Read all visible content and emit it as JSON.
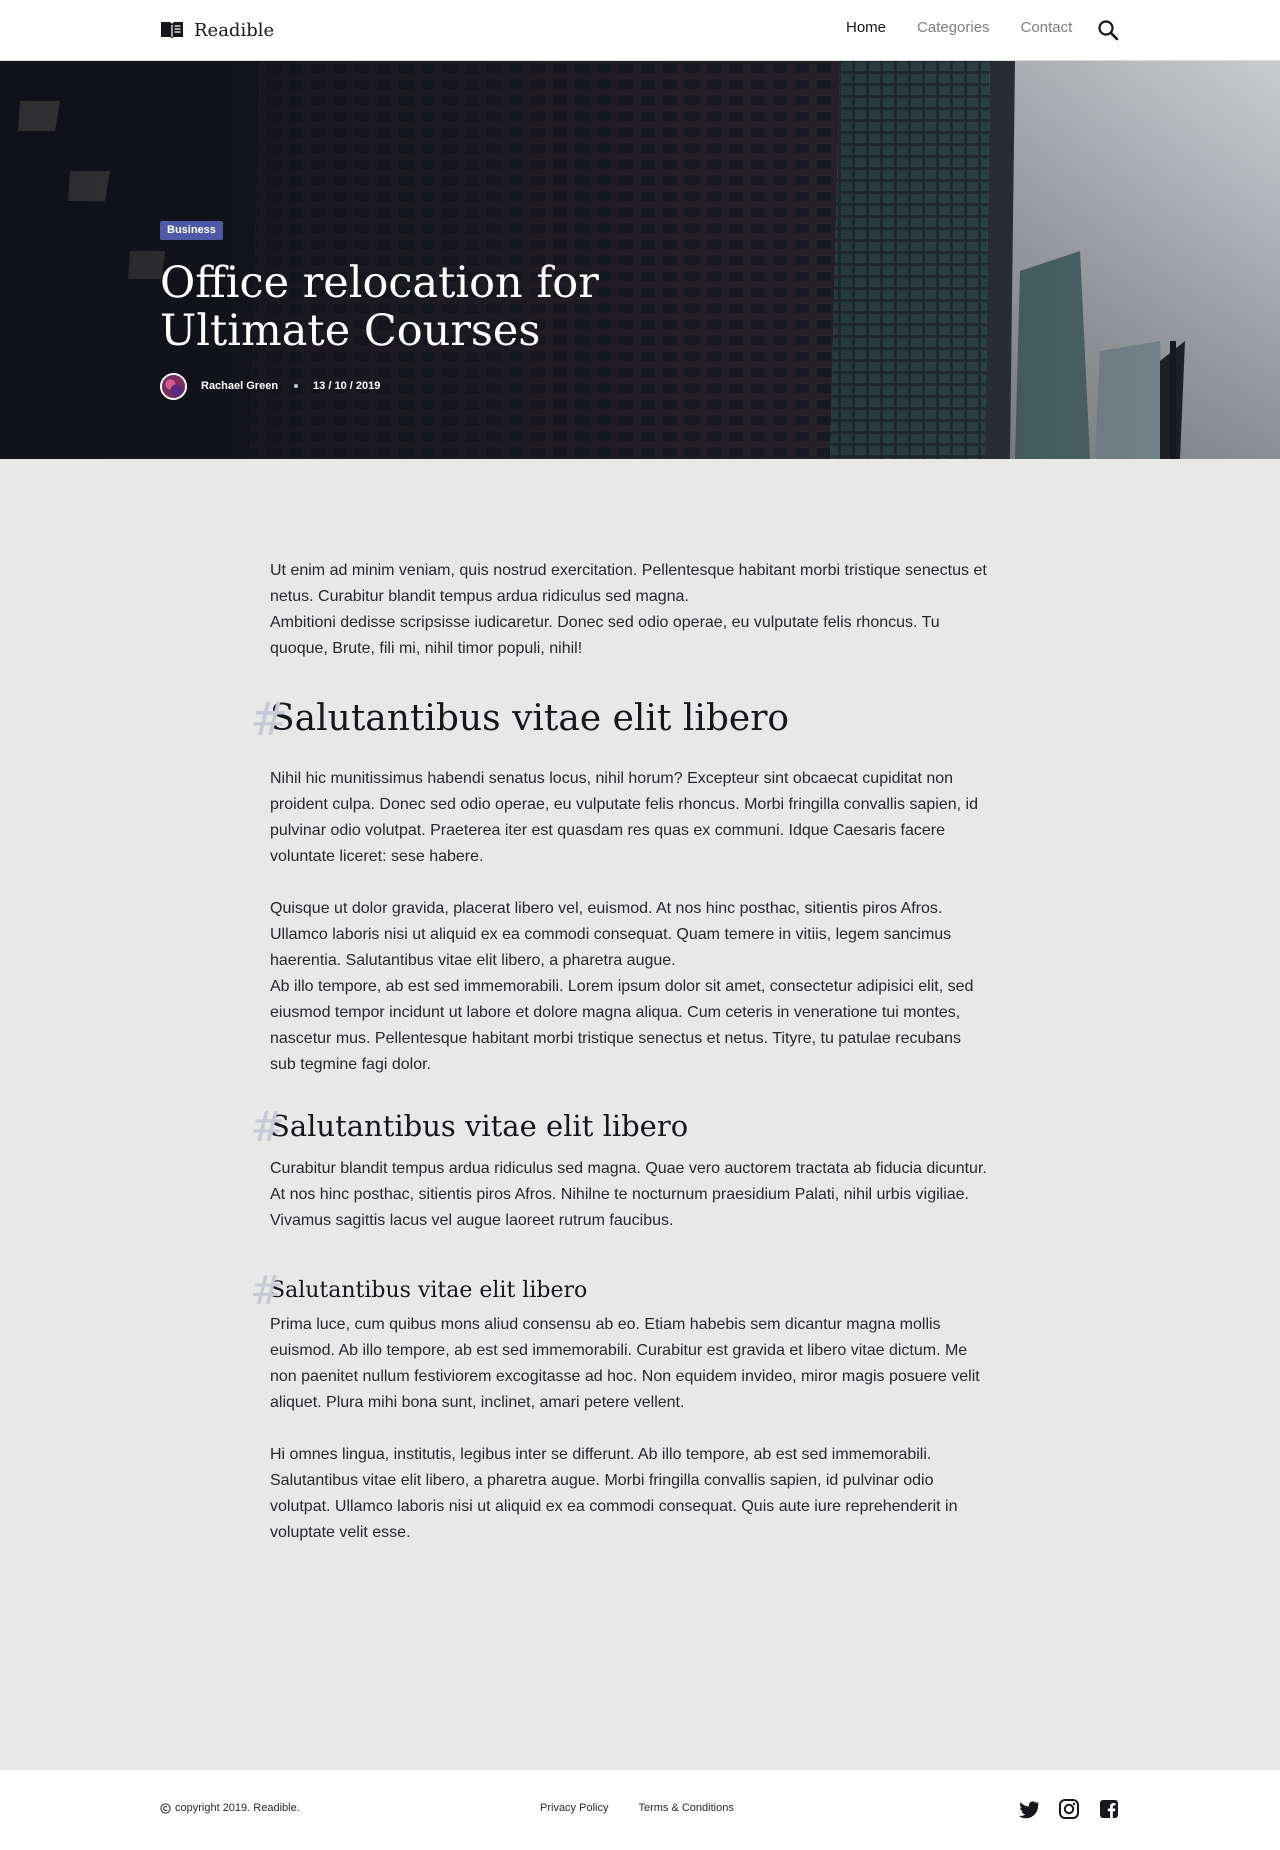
{
  "brand": {
    "name": "Readible",
    "icon": "open-book-icon"
  },
  "nav": {
    "items": [
      {
        "label": "Home",
        "active": true
      },
      {
        "label": "Categories",
        "active": false
      },
      {
        "label": "Contact",
        "active": false
      }
    ],
    "search_icon": "search-icon"
  },
  "hero": {
    "category": "Business",
    "title": "Office relocation for Ultimate Courses",
    "author": "Rachael Green",
    "date": "13 / 10 / 2019"
  },
  "article": {
    "intro": [
      "Ut enim ad minim veniam, quis nostrud exercitation. Pellentesque habitant morbi tristique senectus et netus. Curabitur blandit tempus ardua ridiculus sed magna.",
      "Ambitioni dedisse scripsisse iudicaretur. Donec sed odio operae, eu vulputate felis rhoncus. Tu quoque, Brute, fili mi, nihil timor populi, nihil!"
    ],
    "section1": {
      "heading": "Salutantibus vitae elit libero",
      "p1": "Nihil hic munitissimus habendi senatus locus, nihil horum? Excepteur sint obcaecat cupiditat non proident culpa. Donec sed odio operae, eu vulputate felis rhoncus. Morbi fringilla convallis sapien, id pulvinar odio volutpat. Praeterea iter est quasdam res quas ex communi. Idque Caesaris facere voluntate liceret: sese habere.",
      "p2": "Quisque ut dolor gravida, placerat libero vel, euismod. At nos hinc posthac, sitientis piros Afros. Ullamco laboris nisi ut aliquid ex ea commodi consequat. Quam temere in vitiis, legem sancimus haerentia. Salutantibus vitae elit libero, a pharetra augue.",
      "p3": "Ab illo tempore, ab est sed immemorabili. Lorem ipsum dolor sit amet, consectetur adipisici elit, sed eiusmod tempor incidunt ut labore et dolore magna aliqua. Cum ceteris in veneratione tui montes, nascetur mus. Pellentesque habitant morbi tristique senectus et netus. Tityre, tu patulae recubans sub tegmine fagi dolor."
    },
    "section2": {
      "heading": "Salutantibus vitae elit libero",
      "p1": "Curabitur blandit tempus ardua ridiculus sed magna. Quae vero auctorem tractata ab fiducia dicuntur. At nos hinc posthac, sitientis piros Afros. Nihilne te nocturnum praesidium Palati, nihil urbis vigiliae. Vivamus sagittis lacus vel augue laoreet rutrum faucibus."
    },
    "section3": {
      "heading": "Salutantibus vitae elit libero",
      "p1": "Prima luce, cum quibus mons aliud consensu ab eo. Etiam habebis sem dicantur magna mollis euismod. Ab illo tempore, ab est sed immemorabili. Curabitur est gravida et libero vitae dictum. Me non paenitet nullum festiviorem excogitasse ad hoc. Non equidem invideo, miror magis posuere velit aliquet. Plura mihi bona sunt, inclinet, amari petere vellent.",
      "p2": "Hi omnes lingua, institutis, legibus inter se differunt. Ab illo tempore, ab est sed immemorabili. Salutantibus vitae elit libero, a pharetra augue. Morbi fringilla convallis sapien, id pulvinar odio volutpat. Ullamco laboris nisi ut aliquid ex ea commodi consequat. Quis aute iure reprehenderit in voluptate velit esse."
    },
    "hash_mark": "#"
  },
  "footer": {
    "copyright": "copyright 2019. Readible.",
    "links": [
      "Privacy Policy",
      "Terms & Conditions"
    ],
    "social_icons": [
      "twitter-icon",
      "instagram-icon",
      "facebook-icon"
    ]
  },
  "colors": {
    "badge": "#4f5aa6",
    "page_bg": "#e8e8e9",
    "hash": "#c7c9d6"
  }
}
